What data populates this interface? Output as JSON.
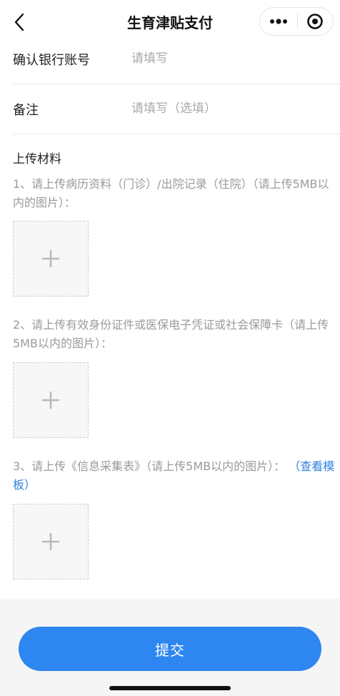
{
  "nav": {
    "title": "生育津贴支付",
    "icons": {
      "back": "chevron-left-icon",
      "more": "more-dots-icon",
      "close": "target-circle-icon"
    }
  },
  "form": {
    "account_confirm": {
      "label": "确认银行账号",
      "placeholder": "请填写",
      "value": ""
    },
    "remark": {
      "label": "备注",
      "placeholder": "请填写（选填）",
      "value": ""
    }
  },
  "upload": {
    "section_title": "上传材料",
    "items": [
      {
        "hint": "1、请上传病历资料（门诊）/出院记录（住院）（请上传5MB以内的图片）：",
        "link": ""
      },
      {
        "hint": "2、请上传有效身份证件或医保电子凭证或社会保障卡（请上传5MB以内的图片）：",
        "link": ""
      },
      {
        "hint": "3、请上传《信息采集表》（请上传5MB以内的图片）：",
        "link": "（查看模板）"
      }
    ],
    "add_icon": "plus-icon"
  },
  "footer": {
    "submit_label": "提交"
  },
  "colors": {
    "accent": "#2e86f0",
    "link": "#2f7fe0",
    "hint": "#9a9a9a",
    "footer_bg": "#f5f5f5"
  }
}
